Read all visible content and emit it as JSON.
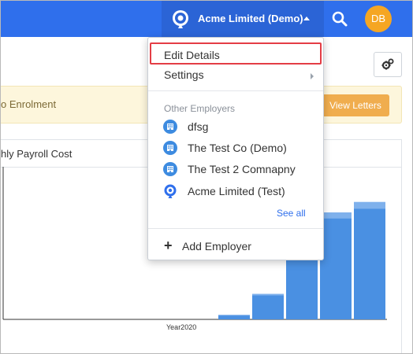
{
  "navbar": {
    "employer_name": "Acme Limited (Demo)",
    "avatar_initials": "DB",
    "brand_color": "#2f6fec"
  },
  "page": {
    "alert_text": "o Enrolment",
    "view_letters_label": "View Letters",
    "panel_title": "hly Payroll Cost"
  },
  "dropdown": {
    "edit_details": "Edit Details",
    "settings": "Settings",
    "other_employers_header": "Other Employers",
    "employers": [
      {
        "name": "dfsg",
        "icon": "building-icon"
      },
      {
        "name": "The Test Co (Demo)",
        "icon": "building-icon"
      },
      {
        "name": "The Test 2 Comnapny",
        "icon": "building-icon"
      },
      {
        "name": "Acme Limited (Test)",
        "icon": "location-pin-icon"
      }
    ],
    "see_all": "See all",
    "add_employer": "Add Employer"
  },
  "chart_data": {
    "type": "bar",
    "xlabel": "",
    "ylabel": "",
    "categories": [
      "",
      "",
      "",
      "",
      ""
    ],
    "x_tick_label": "Year2020",
    "values": [
      5,
      32,
      85,
      135,
      148
    ],
    "stack_top": [
      1,
      2,
      4,
      8,
      9
    ],
    "ylim": [
      0,
      200
    ],
    "bar_color": "#4a90e2",
    "top_color": "#7fb1ec"
  }
}
